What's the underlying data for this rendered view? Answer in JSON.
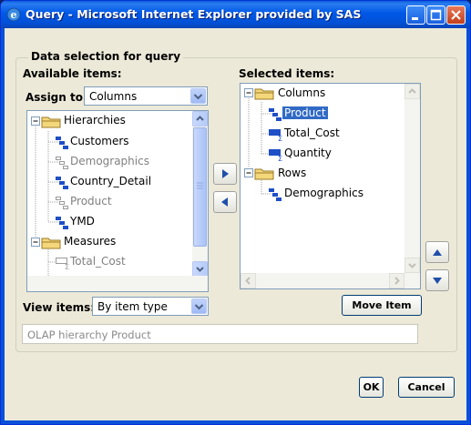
{
  "window": {
    "title": "Query - Microsoft Internet Explorer provided by SAS"
  },
  "dialog": {
    "group_title": "Data selection for query",
    "available_label": "Available items:",
    "assign_label": "Assign to:",
    "assign_value": "Columns",
    "selected_label": "Selected items:",
    "view_label": "View items:",
    "view_value": "By item type",
    "description": "OLAP hierarchy Product",
    "move_item": "Move Item",
    "ok": "OK",
    "cancel": "Cancel"
  },
  "available_tree": {
    "hierarchies": "Hierarchies",
    "items": [
      "Customers",
      "Demographics",
      "Country_Detail",
      "Product",
      "YMD"
    ],
    "measures": "Measures",
    "measure_items": [
      "Total_Cost"
    ]
  },
  "selected_tree": {
    "columns": "Columns",
    "column_items": [
      "Product",
      "Total_Cost",
      "Quantity"
    ],
    "rows": "Rows",
    "row_items": [
      "Demographics"
    ]
  },
  "icons": [
    "ie-icon",
    "minimize-icon",
    "maximize-icon",
    "close-icon",
    "folder-icon",
    "hierarchy-icon",
    "measure-icon",
    "arrow-right-icon",
    "arrow-left-icon",
    "arrow-up-icon",
    "arrow-down-icon"
  ]
}
